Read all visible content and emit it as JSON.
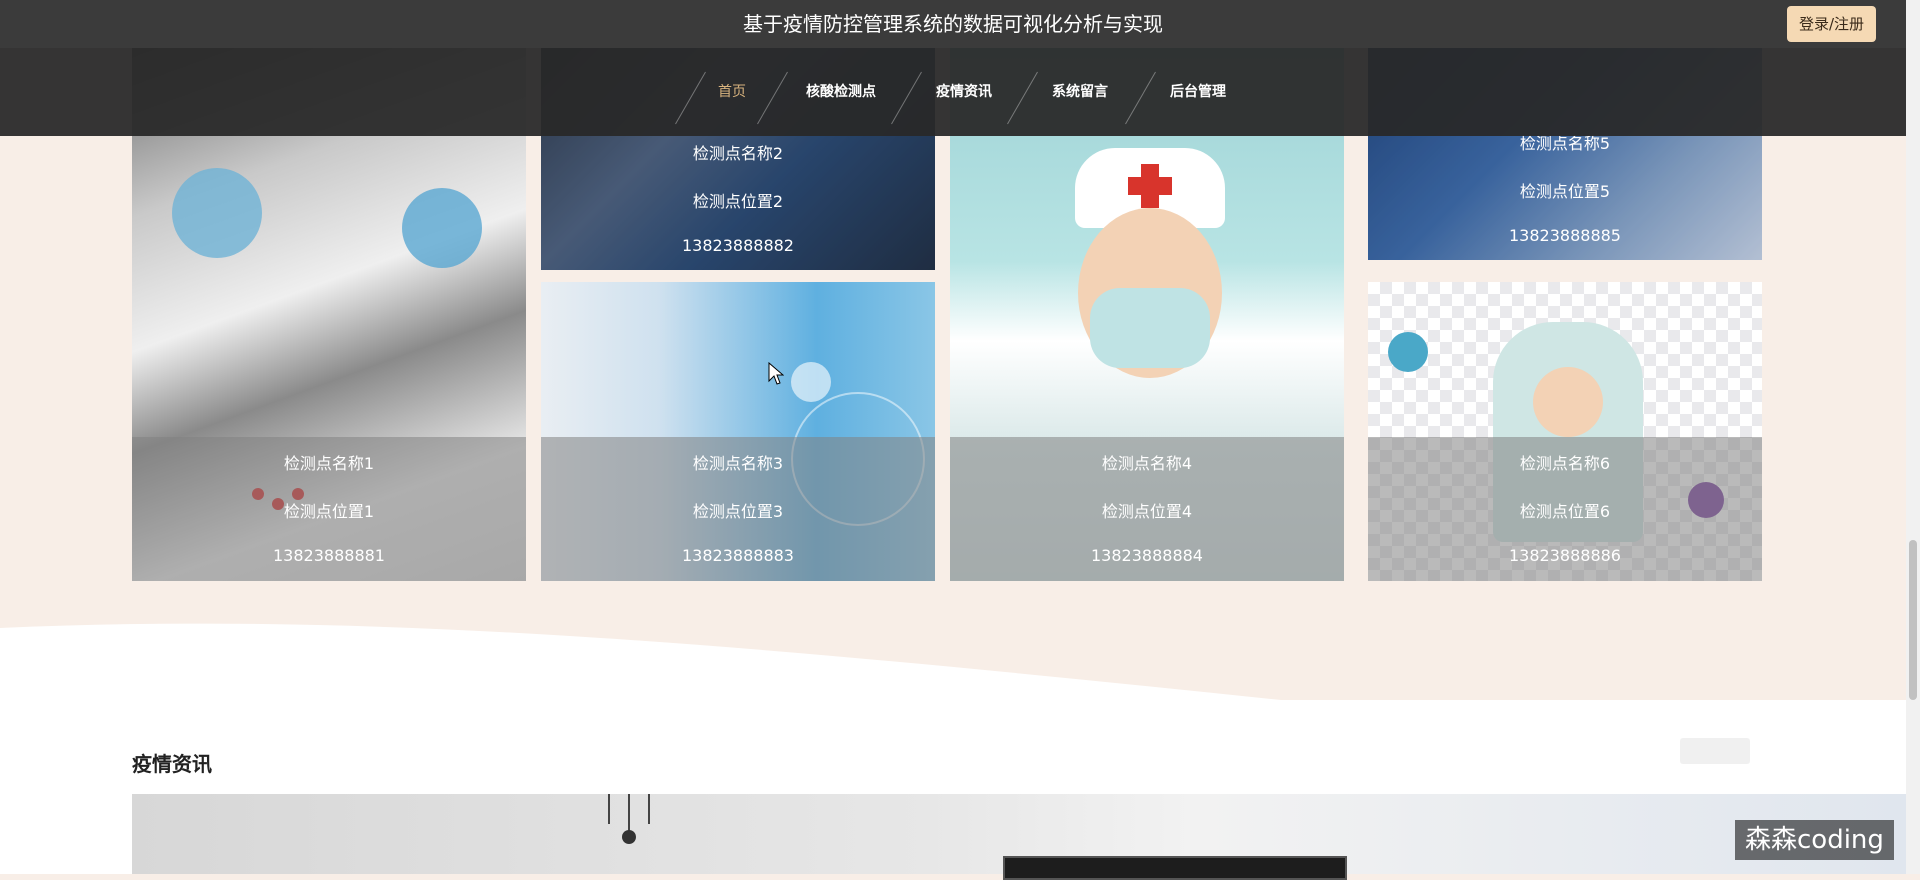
{
  "header": {
    "title": "基于疫情防控管理系统的数据可视化分析与实现",
    "login_label": "登录/注册"
  },
  "nav": {
    "items": [
      {
        "label": "首页",
        "active": true
      },
      {
        "label": "核酸检测点",
        "active": false
      },
      {
        "label": "疫情资讯",
        "active": false
      },
      {
        "label": "系统留言",
        "active": false
      },
      {
        "label": "后台管理",
        "active": false
      }
    ]
  },
  "test_points": [
    {
      "name": "检测点名称1",
      "location": "检测点位置1",
      "phone": "13823888881"
    },
    {
      "name": "检测点名称2",
      "location": "检测点位置2",
      "phone": "13823888882"
    },
    {
      "name": "检测点名称3",
      "location": "检测点位置3",
      "phone": "13823888883"
    },
    {
      "name": "检测点名称4",
      "location": "检测点位置4",
      "phone": "13823888884"
    },
    {
      "name": "检测点名称5",
      "location": "检测点位置5",
      "phone": "13823888885"
    },
    {
      "name": "检测点名称6",
      "location": "检测点位置6",
      "phone": "13823888886"
    }
  ],
  "news_section": {
    "title": "疫情资讯"
  },
  "watermark": "森森coding",
  "colors": {
    "topbar": "#3b3b3b",
    "accent": "#d8b37e",
    "login_bg": "#f5d9b4",
    "page_bg": "#f8eee7"
  }
}
